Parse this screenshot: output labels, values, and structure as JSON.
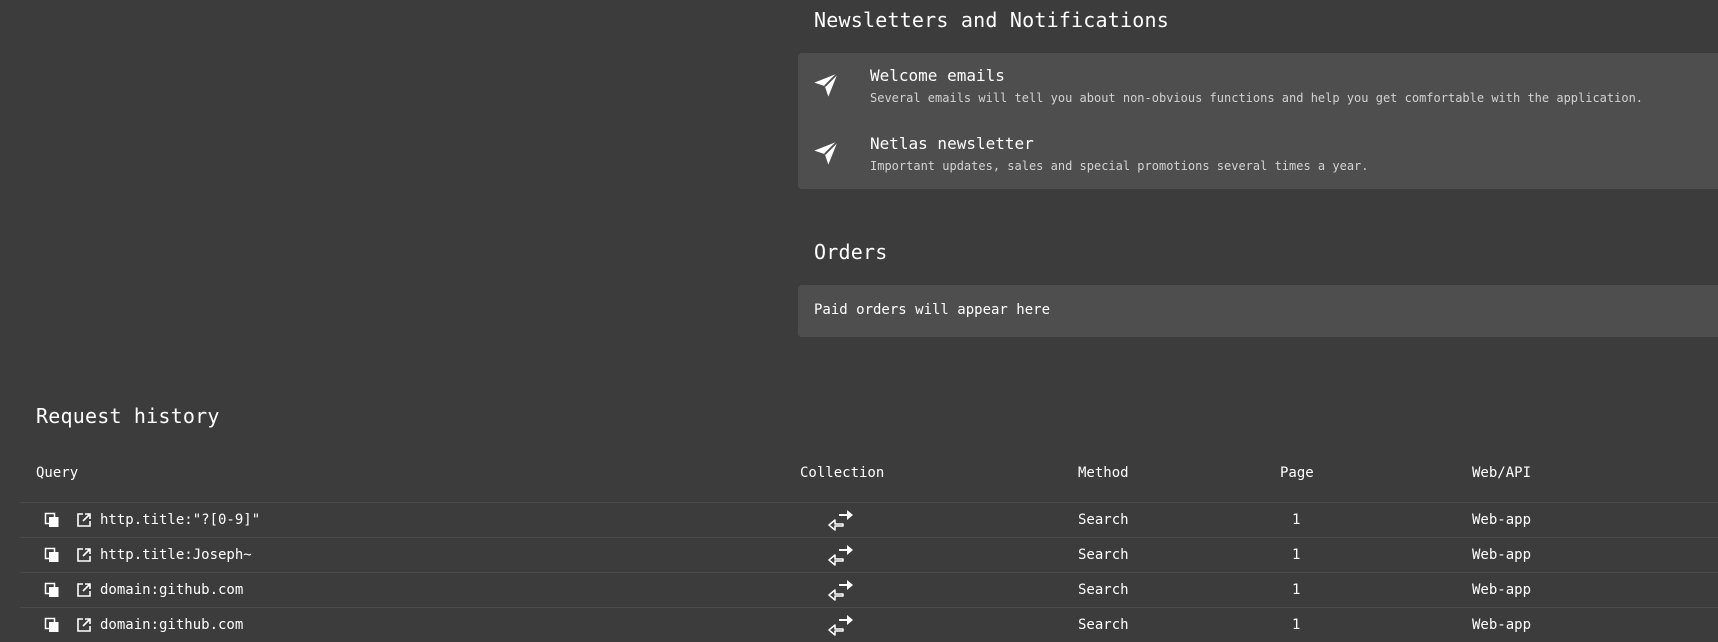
{
  "newsletters": {
    "title": "Newsletters and Notifications",
    "items": [
      {
        "icon": "paper-plane-icon",
        "name": "Welcome emails",
        "description": "Several emails will tell you about non-obvious functions and help you get comfortable with the application."
      },
      {
        "icon": "paper-plane-icon",
        "name": "Netlas newsletter",
        "description": "Important updates, sales and special promotions several times a year."
      }
    ]
  },
  "orders": {
    "title": "Orders",
    "empty_text": "Paid orders will appear here"
  },
  "history": {
    "title": "Request history",
    "columns": {
      "query": "Query",
      "collection": "Collection",
      "method": "Method",
      "page": "Page",
      "source": "Web/API"
    },
    "rows": [
      {
        "query": "http.title:\"?[0-9]\"",
        "collection_icon": "exchange-arrows-icon",
        "method": "Search",
        "page": "1",
        "source": "Web-app"
      },
      {
        "query": "http.title:Joseph~",
        "collection_icon": "exchange-arrows-icon",
        "method": "Search",
        "page": "1",
        "source": "Web-app"
      },
      {
        "query": "domain:github.com",
        "collection_icon": "exchange-arrows-icon",
        "method": "Search",
        "page": "1",
        "source": "Web-app"
      },
      {
        "query": "domain:github.com",
        "collection_icon": "exchange-arrows-icon",
        "method": "Search",
        "page": "1",
        "source": "Web-app"
      }
    ]
  }
}
